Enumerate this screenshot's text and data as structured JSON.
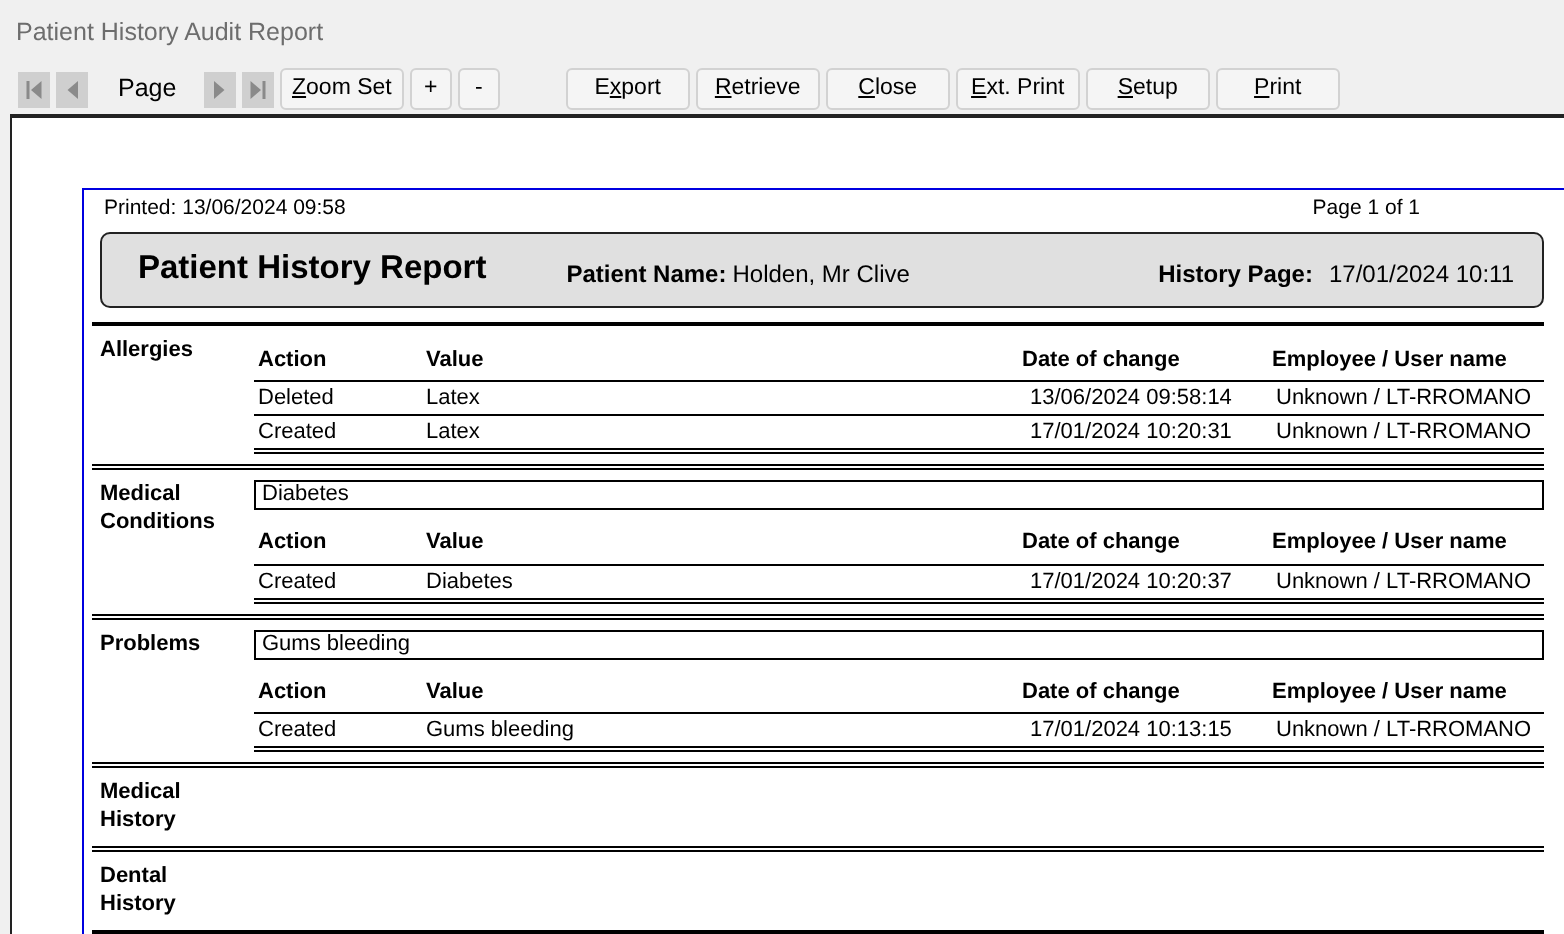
{
  "window": {
    "title": "Patient History Audit Report"
  },
  "toolbar": {
    "nav_first": [
      {
        "kind": "first",
        "disabled": true
      },
      {
        "kind": "prev",
        "disabled": true
      }
    ],
    "page_label": "Page",
    "nav_last": [
      {
        "kind": "next",
        "disabled": true
      },
      {
        "kind": "last",
        "disabled": true
      }
    ],
    "zoom_buttons": [
      {
        "mnemonic": "Z",
        "rest": "oom Set"
      },
      {
        "rest": "+"
      },
      {
        "rest": "-"
      }
    ],
    "action_buttons": [
      {
        "lead": "E",
        "mnemonic": "x",
        "rest": "port"
      },
      {
        "mnemonic": "R",
        "rest": "etrieve"
      },
      {
        "mnemonic": "C",
        "rest": "lose"
      },
      {
        "mnemonic": "E",
        "rest": "xt. Print"
      },
      {
        "mnemonic": "S",
        "rest": "etup"
      },
      {
        "mnemonic": "P",
        "rest": "rint"
      }
    ]
  },
  "report": {
    "printed": "Printed: 13/06/2024 09:58",
    "page": "Page 1 of 1",
    "title": "Patient History Report",
    "patient_label": "Patient Name:",
    "patient_name": "Holden, Mr Clive",
    "history_label": "History Page:",
    "history_date": "17/01/2024 10:11",
    "sections": [
      {
        "name": "Allergies",
        "columns": [
          "Action",
          "Value",
          "Date of change",
          "Employee / User name"
        ],
        "rows": [
          [
            "Deleted",
            "Latex",
            "13/06/2024 09:58:14",
            "Unknown / LT-RROMANO"
          ],
          [
            "Created",
            "Latex",
            "17/01/2024 10:20:31",
            "Unknown / LT-RROMANO"
          ]
        ]
      },
      {
        "name": "Medical Conditions",
        "summary": "Diabetes",
        "columns": [
          "Action",
          "Value",
          "Date of change",
          "Employee / User name"
        ],
        "rows": [
          [
            "Created",
            "Diabetes",
            "17/01/2024 10:20:37",
            "Unknown / LT-RROMANO"
          ]
        ]
      },
      {
        "name": "Problems",
        "summary": "Gums bleeding",
        "columns": [
          "Action",
          "Value",
          "Date of change",
          "Employee / User name"
        ],
        "rows": [
          [
            "Created",
            "Gums bleeding",
            "17/01/2024 10:13:15",
            "Unknown / LT-RROMANO"
          ]
        ]
      },
      {
        "name": "Medical History"
      },
      {
        "name": "Dental History"
      }
    ]
  }
}
